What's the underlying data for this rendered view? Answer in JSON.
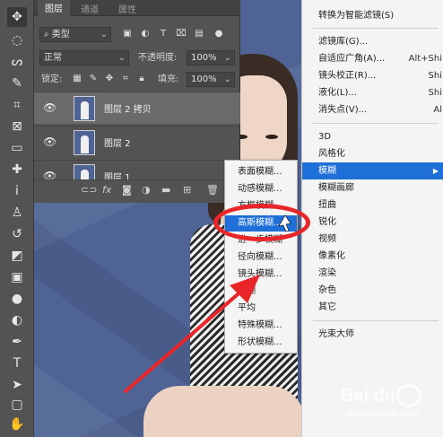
{
  "layers_panel": {
    "tabs": [
      "图层",
      "通道",
      "属性"
    ],
    "filter_kind": "类型",
    "blend_mode": "正常",
    "opacity_label": "不透明度:",
    "opacity_value": "100%",
    "lock_label": "锁定:",
    "fill_label": "填充:",
    "fill_value": "100%",
    "layers": [
      {
        "name": "图层 2 拷贝",
        "selected": true
      },
      {
        "name": "图层 2",
        "selected": false
      },
      {
        "name": "图层 1",
        "selected": false
      }
    ],
    "footer_icons": [
      "link-icon",
      "fx-icon",
      "mask-icon",
      "adjustment-icon",
      "group-icon",
      "new-layer-icon",
      "trash-icon"
    ]
  },
  "filter_menu": {
    "items": [
      {
        "label": "转换为智能滤镜(S)",
        "shortcut": ""
      },
      {
        "label": "滤镜库(G)...",
        "shortcut": ""
      },
      {
        "label": "自适应广角(A)...",
        "shortcut": "Alt+Shi"
      },
      {
        "label": "镜头校正(R)...",
        "shortcut": "Shi"
      },
      {
        "label": "液化(L)...",
        "shortcut": "Shi"
      },
      {
        "label": "消失点(V)...",
        "shortcut": "Al"
      },
      {
        "label": "3D",
        "shortcut": ""
      },
      {
        "label": "风格化",
        "shortcut": ""
      },
      {
        "label": "模糊",
        "shortcut": ""
      },
      {
        "label": "模糊画廊",
        "shortcut": ""
      },
      {
        "label": "扭曲",
        "shortcut": ""
      },
      {
        "label": "锐化",
        "shortcut": ""
      },
      {
        "label": "视频",
        "shortcut": ""
      },
      {
        "label": "像素化",
        "shortcut": ""
      },
      {
        "label": "渲染",
        "shortcut": ""
      },
      {
        "label": "杂色",
        "shortcut": ""
      },
      {
        "label": "其它",
        "shortcut": ""
      },
      {
        "label": "光束大师",
        "shortcut": ""
      }
    ],
    "highlighted": "模糊"
  },
  "blur_submenu": {
    "items": [
      "表面模糊...",
      "动感模糊...",
      "方框模糊...",
      "高斯模糊...",
      "进一步模糊",
      "径向模糊...",
      "镜头模糊...",
      "模糊",
      "平均",
      "特殊模糊...",
      "形状模糊..."
    ],
    "highlighted": "高斯模糊..."
  },
  "watermark": {
    "main": "Bai du",
    "sub": "jingyan.baidu.com"
  },
  "colors": {
    "highlight": "#1f6fd8",
    "annotation_red": "#e8262a",
    "canvas_blue": "#4f6495"
  }
}
